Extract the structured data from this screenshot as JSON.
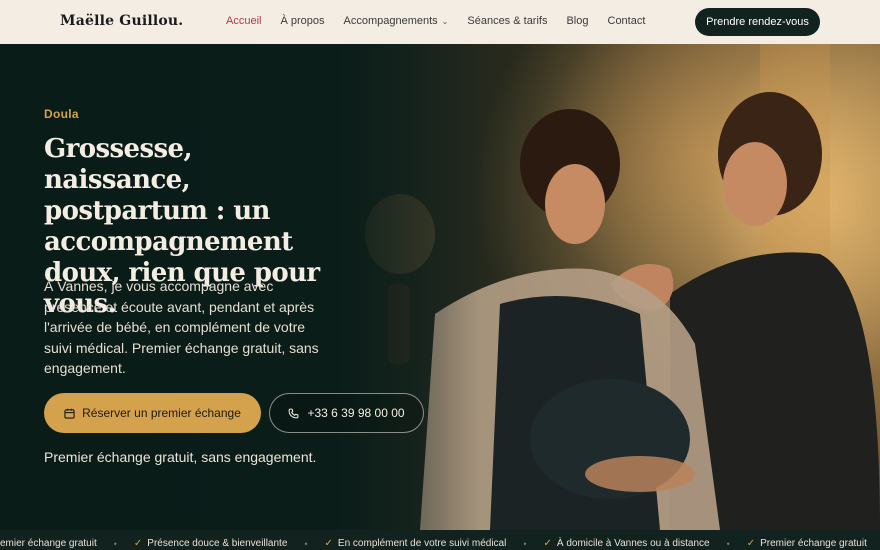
{
  "header": {
    "logo": "Maëlle Guillou.",
    "nav": [
      {
        "label": "Accueil",
        "active": true
      },
      {
        "label": "À propos"
      },
      {
        "label": "Accompagnements",
        "dropdown": true
      },
      {
        "label": "Séances & tarifs"
      },
      {
        "label": "Blog"
      },
      {
        "label": "Contact"
      }
    ],
    "cta": "Prendre rendez-vous"
  },
  "hero": {
    "eyebrow": "Doula",
    "title": "Grossesse, naissance, postpartum : un accompagnement doux, rien que pour vous.",
    "description": "À Vannes, je vous accompagne avec présence et écoute avant, pendant et après l'arrivée de bébé, en complément de votre suivi médical. Premier échange gratuit, sans engagement.",
    "primary_button": "Réserver un premier échange",
    "primary_icon": "calendar-icon",
    "phone_button": "+33 6 39 98 00 00",
    "phone_icon": "phone-icon",
    "note": "Premier échange gratuit, sans engagement."
  },
  "marquee": {
    "items": [
      "Premier échange gratuit",
      "Présence douce & bienveillante",
      "En complément de votre suivi médical",
      "À domicile à Vannes ou à distance",
      "Premier échange gratuit"
    ]
  },
  "colors": {
    "accent": "#d4a24c",
    "active_nav": "#b0394b",
    "dark": "#12221e",
    "cream": "#f4ede4"
  }
}
